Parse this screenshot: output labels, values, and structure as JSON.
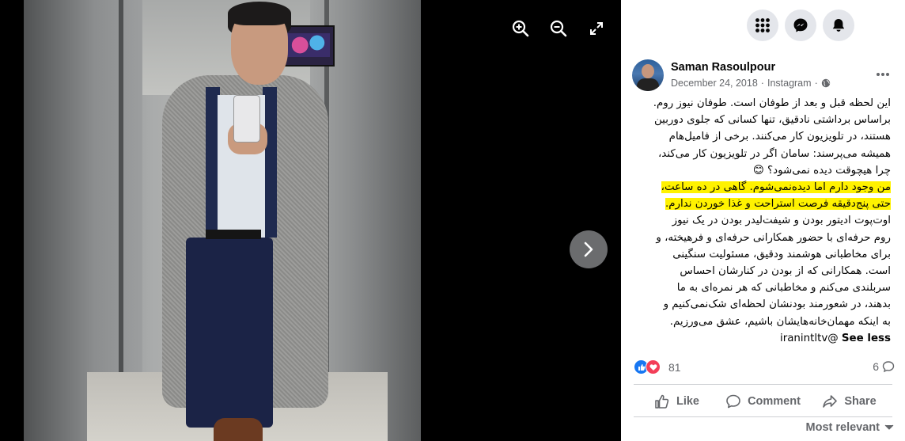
{
  "viewer": {
    "zoom_in_icon": "zoom-in-icon",
    "zoom_out_icon": "zoom-out-icon",
    "fullscreen_icon": "fullscreen-icon",
    "next_icon": "chevron-right-icon"
  },
  "top_bar": {
    "icons": [
      "menu-grid-icon",
      "messenger-icon",
      "notifications-bell-icon"
    ]
  },
  "post": {
    "author": "Saman Rasoulpour",
    "date": "December 24, 2018",
    "separator": "·",
    "source": "Instagram",
    "separator2": "·",
    "privacy_icon": "globe-icon",
    "text_lines": [
      "این لحظه قبل و بعد از طوفان است. طوفان نیوز روم.",
      "براساس برداشتی نادقیق، تنها کسانی که جلوی دوربین",
      "هستند، در تلویزیون کار می‌کنند. برخی از فامیل‌هام",
      "همیشه می‌پرسند: سامان اگر در تلویزیون کار می‌کند،",
      "چرا هیچوقت دیده نمی‌شود؟ 😊",
      "من وجود دارم اما دیده‌نمی‌شوم. گاهی در ده ساعت،",
      "حتی پنج‌دقیقه فرصت استراحت و غذا خوردن ندارم.",
      "اوت‌پوت ادیتور بودن و شیفت‌لیدر بودن در یک نیوز",
      "روم حرفه‌ای با حضور همکارانی حرفه‌ای و فرهیخته، و",
      "برای مخاطبانی هوشمند ودقیق، مسئولیت سنگینی",
      "است. همکارانی که از بودن در کنارشان احساس",
      "سربلندی می‌کنم و مخاطبانی که هر نمره‌ای به ما",
      "بدهند، در شعورمند بودنشان لحظه‌ای شک‌نمی‌کنیم و",
      "به اینکه مهمان‌خانه‌هایشان باشیم، عشق می‌ورزیم."
    ],
    "last_line_tag": "iranintltv@",
    "see_less": "See less",
    "reaction_count": "81",
    "comment_count": "6",
    "like_label": "Like",
    "comment_label": "Comment",
    "share_label": "Share",
    "sort_label": "Most relevant"
  },
  "colors": {
    "highlight": "#fff200",
    "like_blue": "#1877f2",
    "love_red": "#f33e58",
    "muted_text": "#65676b"
  }
}
